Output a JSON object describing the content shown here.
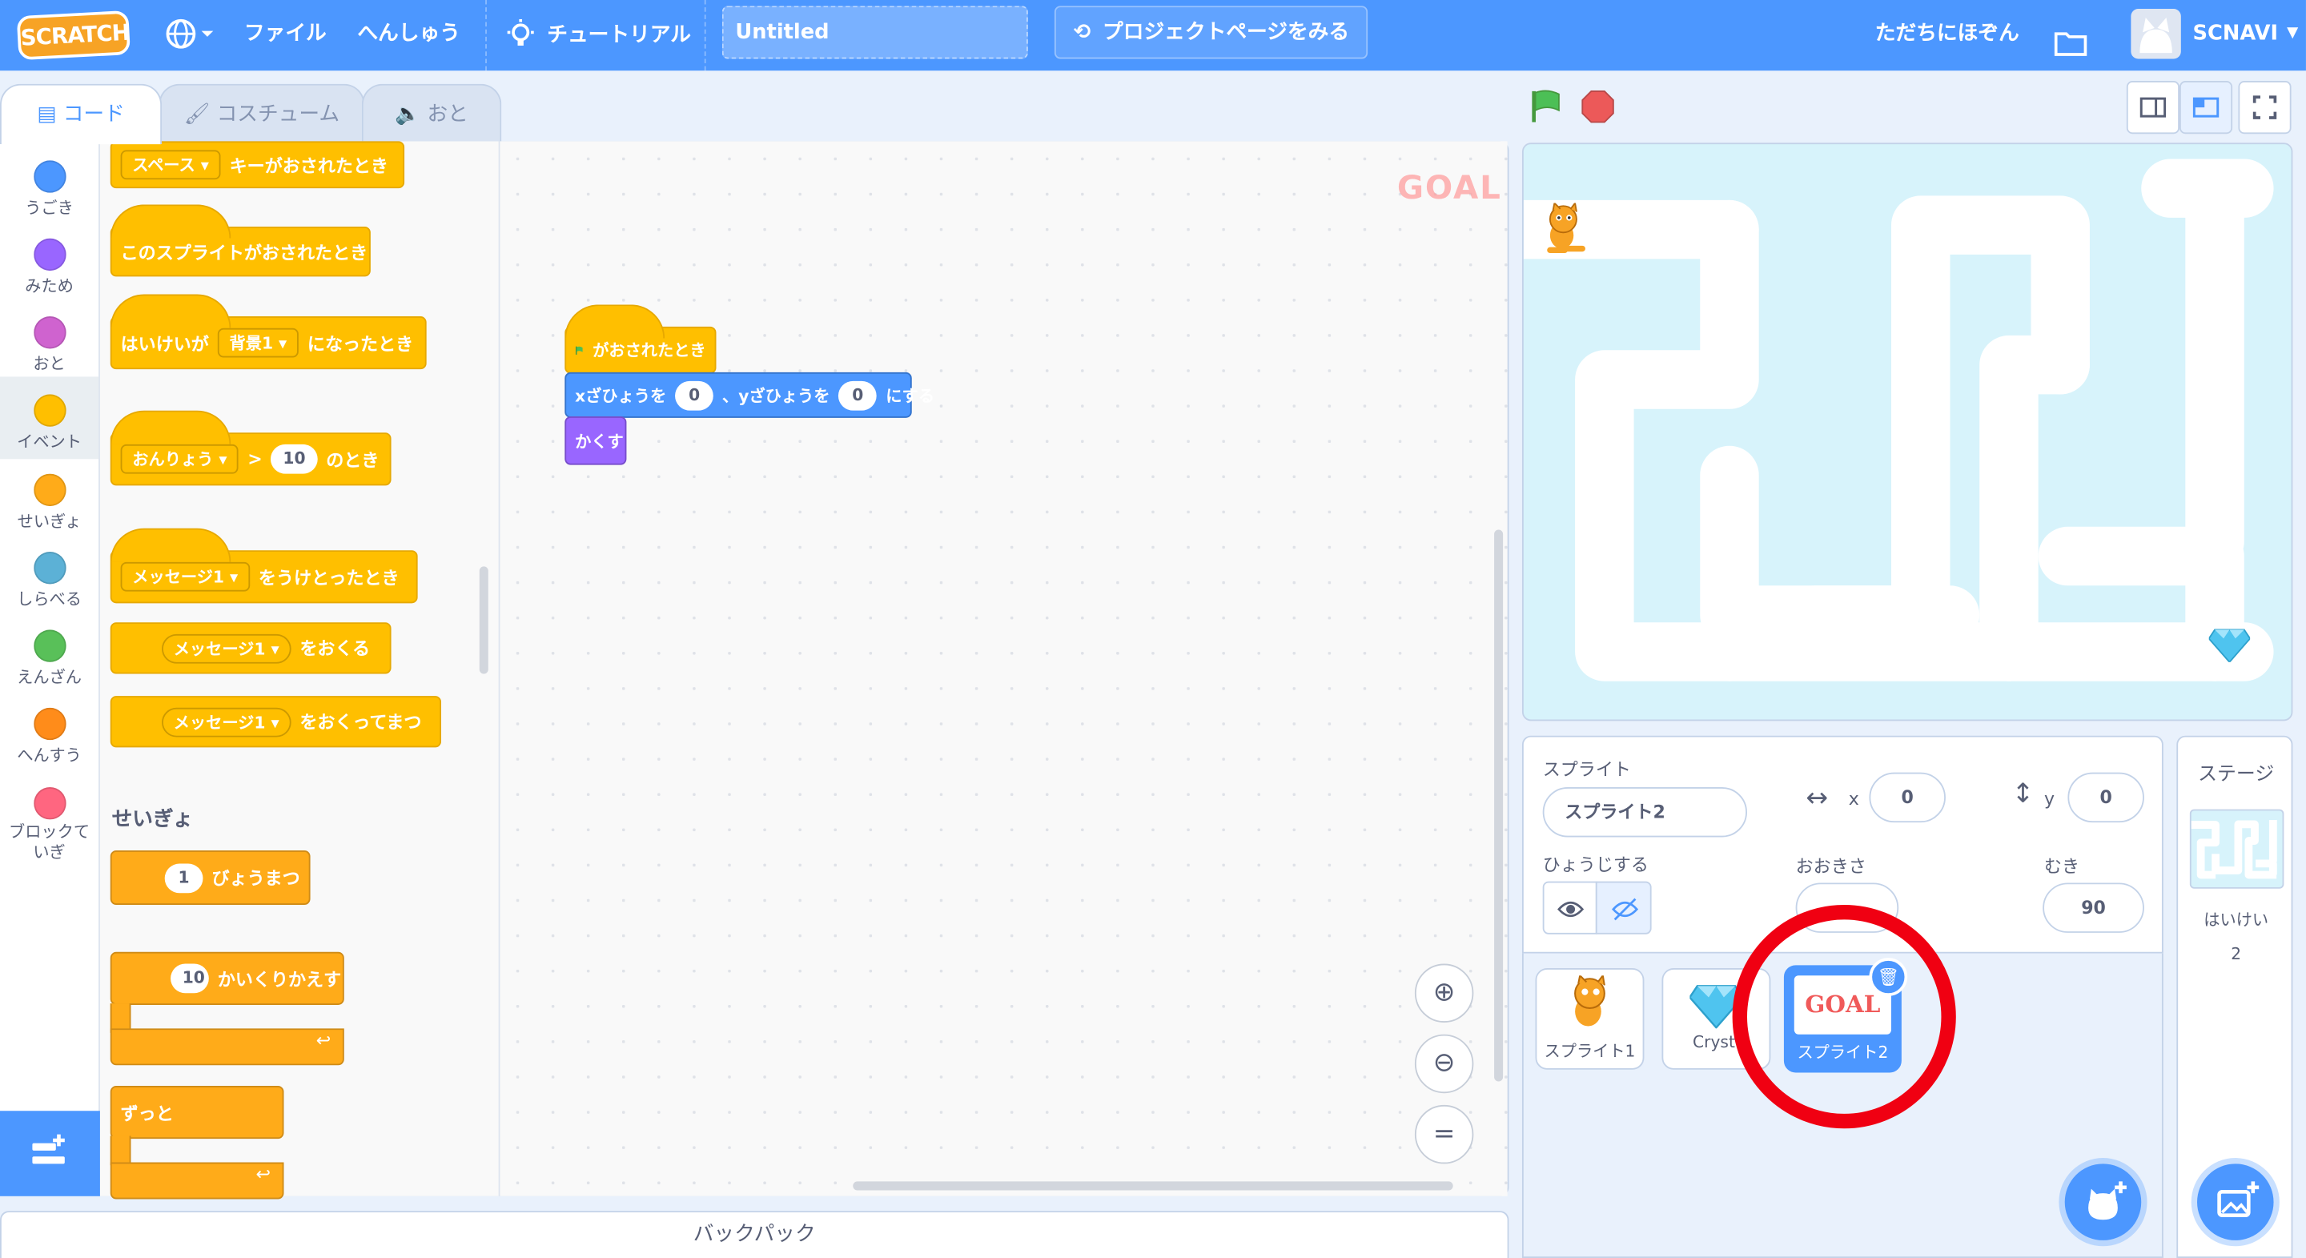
{
  "menubar": {
    "logo": "SCRATCH",
    "file": "ファイル",
    "edit": "へんしゅう",
    "tutorials": "チュートリアル",
    "project_title": "Untitled",
    "see_project_page": "プロジェクトページをみる",
    "share": "ただちにほぞん",
    "username": "SCNAVI"
  },
  "tabs": {
    "code": "コード",
    "costumes": "コスチューム",
    "sounds": "おと"
  },
  "categories": [
    {
      "label": "うごき",
      "color": "#4c97ff"
    },
    {
      "label": "みため",
      "color": "#9966ff"
    },
    {
      "label": "おと",
      "color": "#cf63cf"
    },
    {
      "label": "イベント",
      "color": "#ffbf00"
    },
    {
      "label": "せいぎょ",
      "color": "#ffab19"
    },
    {
      "label": "しらべる",
      "color": "#5cb1d6"
    },
    {
      "label": "えんざん",
      "color": "#59c059"
    },
    {
      "label": "へんすう",
      "color": "#ff8c1a"
    },
    {
      "label": "ブロックていぎ",
      "color": "#ff6680"
    }
  ],
  "palette": {
    "key_pressed": {
      "key": "スペース",
      "text": "キーがおされたとき"
    },
    "sprite_clicked": "このスプライトがおされたとき",
    "backdrop_switch": {
      "prefix": "はいけいが",
      "backdrop": "背景1",
      "suffix": "になったとき"
    },
    "when_greater": {
      "sensor": "おんりょう",
      "op": ">",
      "value": "10",
      "suffix": "のとき"
    },
    "receive": {
      "message": "メッセージ1",
      "text": "をうけとったとき"
    },
    "broadcast": {
      "message": "メッセージ1",
      "text": "をおくる"
    },
    "broadcast_wait": {
      "message": "メッセージ1",
      "text": "をおくってまつ"
    },
    "control_label": "せいぎょ",
    "wait": {
      "value": "1",
      "text": "びょうまつ"
    },
    "repeat": {
      "value": "10",
      "text": "かいくりかえす"
    },
    "forever": "ずっと"
  },
  "script": {
    "flag_hat": "がおされたとき",
    "goto": {
      "x_label": "xざひょうを",
      "x": "0",
      "sep": "、yざひょうを",
      "y": "0",
      "suffix": "にする"
    },
    "hide": "かくす"
  },
  "workspace": {
    "costume_preview_text": "GOAL"
  },
  "backpack": "バックパック",
  "sprite_info": {
    "sprite_label": "スプライト",
    "sprite_name": "スプライト2",
    "x_label": "x",
    "x": "0",
    "y_label": "y",
    "y": "0",
    "show_label": "ひょうじする",
    "size_label": "おおきさ",
    "direction_label": "むき",
    "direction": "90"
  },
  "sprites": [
    {
      "name": "スプライト1"
    },
    {
      "name": "Cryst"
    },
    {
      "name": "スプライト2",
      "costume_text": "GOAL"
    }
  ],
  "stage_panel": {
    "title": "ステージ",
    "backdrops_label": "はいけい",
    "backdrops_count": "2"
  },
  "colors": {
    "accent": "#4c97ff",
    "events": "#ffbf00",
    "highlight_circle": "#f00012"
  }
}
